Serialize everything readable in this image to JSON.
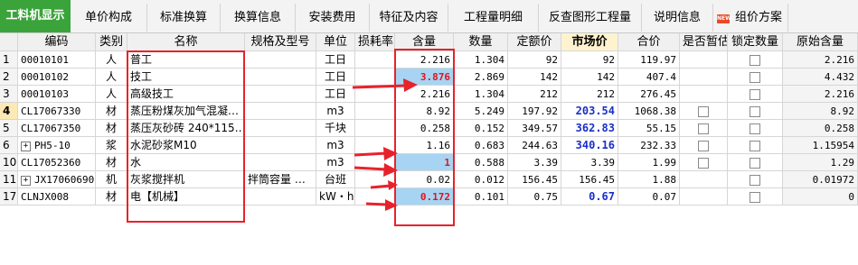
{
  "tabs": [
    {
      "label": "工料机显示"
    },
    {
      "label": "单价构成"
    },
    {
      "label": "标准换算"
    },
    {
      "label": "换算信息"
    },
    {
      "label": "安装费用"
    },
    {
      "label": "特征及内容"
    },
    {
      "label": "工程量明细"
    },
    {
      "label": "反查图形工程量"
    },
    {
      "label": "说明信息"
    },
    {
      "label": "组价方案",
      "badge": "NEW"
    }
  ],
  "columns": [
    "编码",
    "类别",
    "名称",
    "规格及型号",
    "单位",
    "损耗率",
    "含量",
    "数量",
    "定额价",
    "市场价",
    "合价",
    "是否暂估",
    "锁定数量",
    "原始含量"
  ],
  "rows": [
    {
      "no": "1",
      "code": "00010101",
      "cat": "人",
      "name": "普工",
      "spec": "",
      "unit": "工日",
      "loss": "",
      "qty": "2.216",
      "amount": "1.304",
      "quota": "92",
      "market": "92",
      "total": "119.97",
      "est": false,
      "lock": true,
      "orig": "2.216"
    },
    {
      "no": "2",
      "code": "00010102",
      "cat": "人",
      "name": "技工",
      "spec": "",
      "unit": "工日",
      "loss": "",
      "qty": "3.876",
      "amount": "2.869",
      "quota": "142",
      "market": "142",
      "total": "407.4",
      "est": false,
      "lock": true,
      "orig": "4.432"
    },
    {
      "no": "3",
      "code": "00010103",
      "cat": "人",
      "name": "高级技工",
      "spec": "",
      "unit": "工日",
      "loss": "",
      "qty": "2.216",
      "amount": "1.304",
      "quota": "212",
      "market": "212",
      "total": "276.45",
      "est": false,
      "lock": true,
      "orig": "2.216"
    },
    {
      "no": "4",
      "code": "CL17067330",
      "cat": "材",
      "name": "蒸压粉煤灰加气混凝…",
      "spec": "",
      "unit": "m3",
      "loss": "",
      "qty": "8.92",
      "amount": "5.249",
      "quota": "197.92",
      "market": "203.54",
      "total": "1068.38",
      "est": true,
      "lock": true,
      "orig": "8.92"
    },
    {
      "no": "5",
      "code": "CL17067350",
      "cat": "材",
      "name": "蒸压灰砂砖 240*115…",
      "spec": "",
      "unit": "千块",
      "loss": "",
      "qty": "0.258",
      "amount": "0.152",
      "quota": "349.57",
      "market": "362.83",
      "total": "55.15",
      "est": true,
      "lock": true,
      "orig": "0.258"
    },
    {
      "no": "6",
      "code": "PH5-10",
      "cat": "浆",
      "name": "水泥砂浆M10",
      "spec": "",
      "unit": "m3",
      "loss": "",
      "qty": "1.16",
      "amount": "0.683",
      "quota": "244.63",
      "market": "340.16",
      "total": "232.33",
      "est": true,
      "lock": true,
      "orig": "1.15954",
      "expand": true
    },
    {
      "no": "10",
      "code": "CL17052360",
      "cat": "材",
      "name": "水",
      "spec": "",
      "unit": "m3",
      "loss": "",
      "qty": "1",
      "amount": "0.588",
      "quota": "3.39",
      "market": "3.39",
      "total": "1.99",
      "est": true,
      "lock": true,
      "orig": "1.29"
    },
    {
      "no": "11",
      "code": "JX17060690",
      "cat": "机",
      "name": "灰浆搅拌机",
      "spec": "拌筒容量 …",
      "unit": "台班",
      "loss": "",
      "qty": "0.02",
      "amount": "0.012",
      "quota": "156.45",
      "market": "156.45",
      "total": "1.88",
      "est": false,
      "lock": true,
      "orig": "0.01972",
      "expand": true
    },
    {
      "no": "17",
      "code": "CLNJX008",
      "cat": "材",
      "name": "电【机械】",
      "spec": "",
      "unit": "kW・h",
      "loss": "",
      "qty": "0.172",
      "amount": "0.101",
      "quota": "0.75",
      "market": "0.67",
      "total": "0.07",
      "est": false,
      "lock": true,
      "orig": "0"
    }
  ],
  "colors": {
    "tab_active": "#3aa33a",
    "annotation_red": "#e8222b",
    "selected_cell": "#a7d4f2",
    "market_blue": "#1a2fc8"
  }
}
